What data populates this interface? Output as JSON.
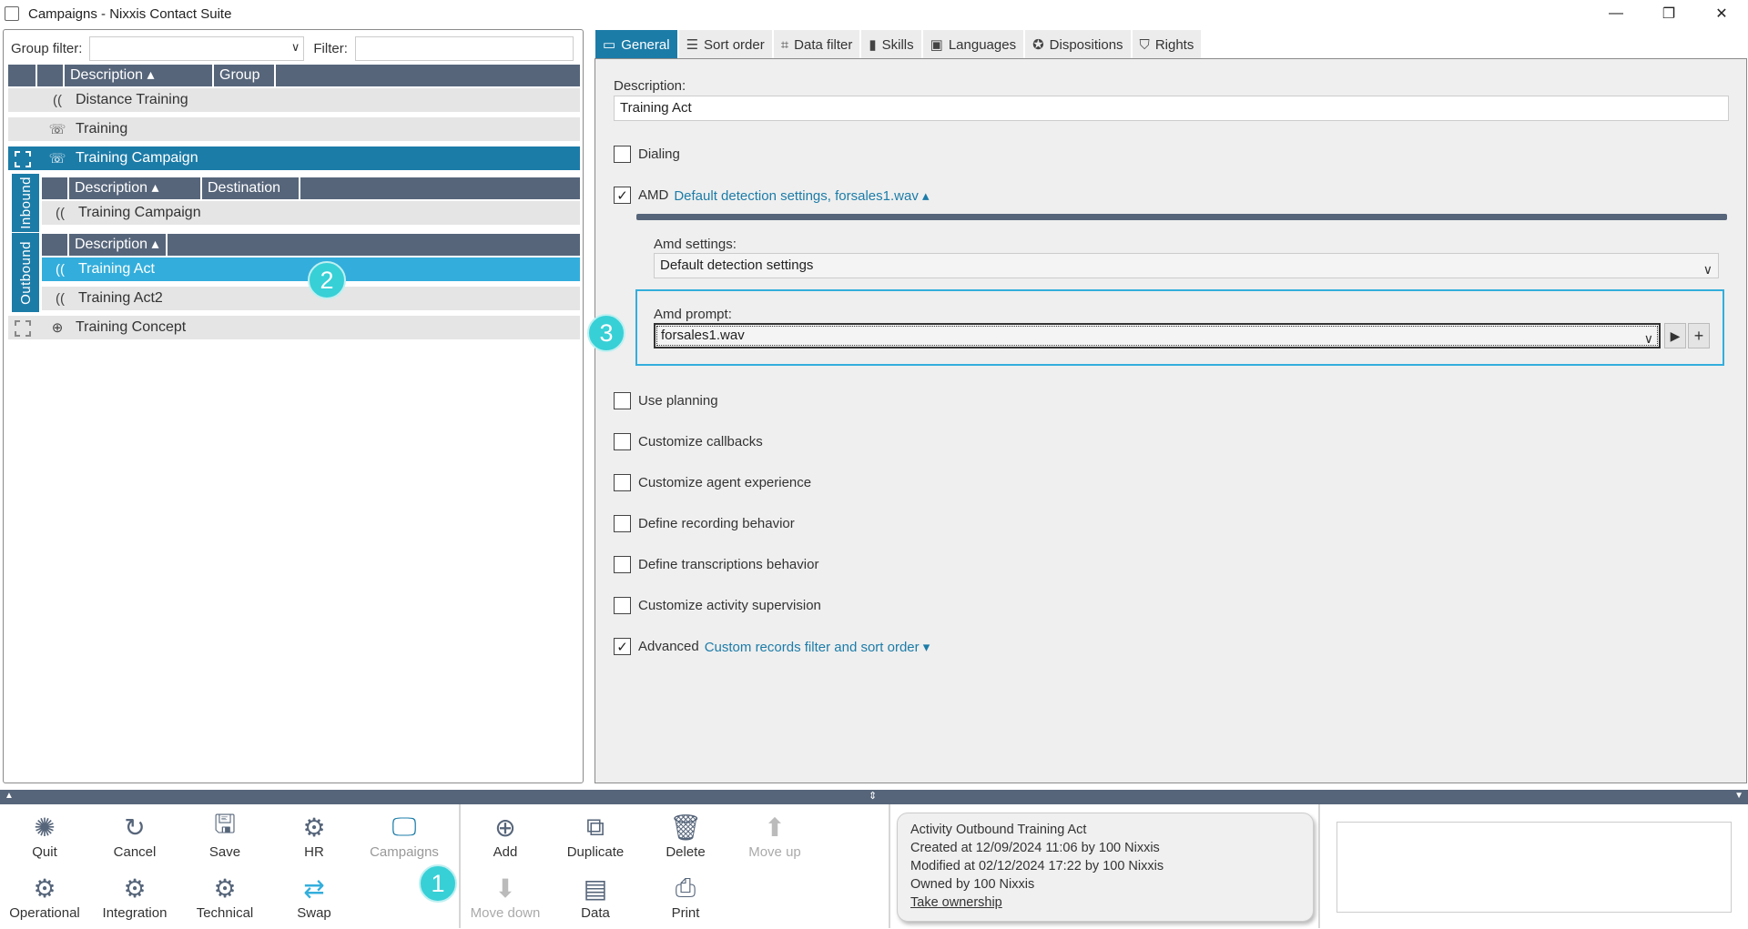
{
  "window": {
    "title": "Campaigns - Nixxis Contact Suite",
    "minimize": "—",
    "restore": "❐",
    "close": "✕"
  },
  "left": {
    "group_filter_label": "Group filter:",
    "filter_label": "Filter:",
    "header": {
      "description": "Description ▴",
      "group": "Group"
    },
    "items": [
      {
        "label": "Distance Training"
      },
      {
        "label": "Training"
      },
      {
        "label": "Training Campaign"
      },
      {
        "label": "Training Concept"
      }
    ],
    "inbound_tab": "Inbound",
    "outbound_tab": "Outbound",
    "inbound_header": {
      "description": "Description ▴",
      "destination": "Destination"
    },
    "inbound_items": [
      {
        "label": "Training Campaign"
      }
    ],
    "outbound_header": {
      "description": "Description ▴"
    },
    "outbound_items": [
      {
        "label": "Training Act"
      },
      {
        "label": "Training Act2"
      }
    ]
  },
  "badges": {
    "b1": "1",
    "b2": "2",
    "b3": "3"
  },
  "tabs": [
    {
      "label": "General",
      "icon": "monitor-icon"
    },
    {
      "label": "Sort order",
      "icon": "sort-icon"
    },
    {
      "label": "Data filter",
      "icon": "filter-icon"
    },
    {
      "label": "Skills",
      "icon": "book-icon"
    },
    {
      "label": "Languages",
      "icon": "languages-icon"
    },
    {
      "label": "Dispositions",
      "icon": "badge-icon"
    },
    {
      "label": "Rights",
      "icon": "shield-icon"
    }
  ],
  "general": {
    "description_label": "Description:",
    "description_value": "Training Act",
    "dialing": "Dialing",
    "amd": "AMD",
    "amd_link": "Default detection settings, forsales1.wav ▴",
    "amd_settings_label": "Amd settings:",
    "amd_settings_value": "Default detection settings",
    "amd_prompt_label": "Amd prompt:",
    "amd_prompt_value": "forsales1.wav",
    "use_planning": "Use planning",
    "customize_callbacks": "Customize callbacks",
    "customize_agent_experience": "Customize agent experience",
    "define_recording": "Define recording behavior",
    "define_transcriptions": "Define transcriptions behavior",
    "customize_supervision": "Customize activity supervision",
    "advanced": "Advanced",
    "advanced_link": "Custom records filter and sort order ▾"
  },
  "toolbar": {
    "quit": "Quit",
    "cancel": "Cancel",
    "save": "Save",
    "hr": "HR",
    "campaigns": "Campaigns",
    "operational": "Operational",
    "integration": "Integration",
    "technical": "Technical",
    "swap": "Swap",
    "add": "Add",
    "duplicate": "Duplicate",
    "delete": "Delete",
    "move_up": "Move up",
    "move_down": "Move down",
    "data": "Data",
    "print": "Print"
  },
  "info": {
    "line1": "Activity Outbound Training Act",
    "line2": "Created at 12/09/2024 11:06 by 100 Nixxis",
    "line3": "Modified at 02/12/2024 17:22 by 100 Nixxis",
    "line4": "Owned by 100 Nixxis",
    "take_ownership": "Take ownership"
  },
  "colors": {
    "accent": "#1c7ca8",
    "selection": "#33aedc",
    "header": "#56657a",
    "badge": "#37d0d6"
  }
}
